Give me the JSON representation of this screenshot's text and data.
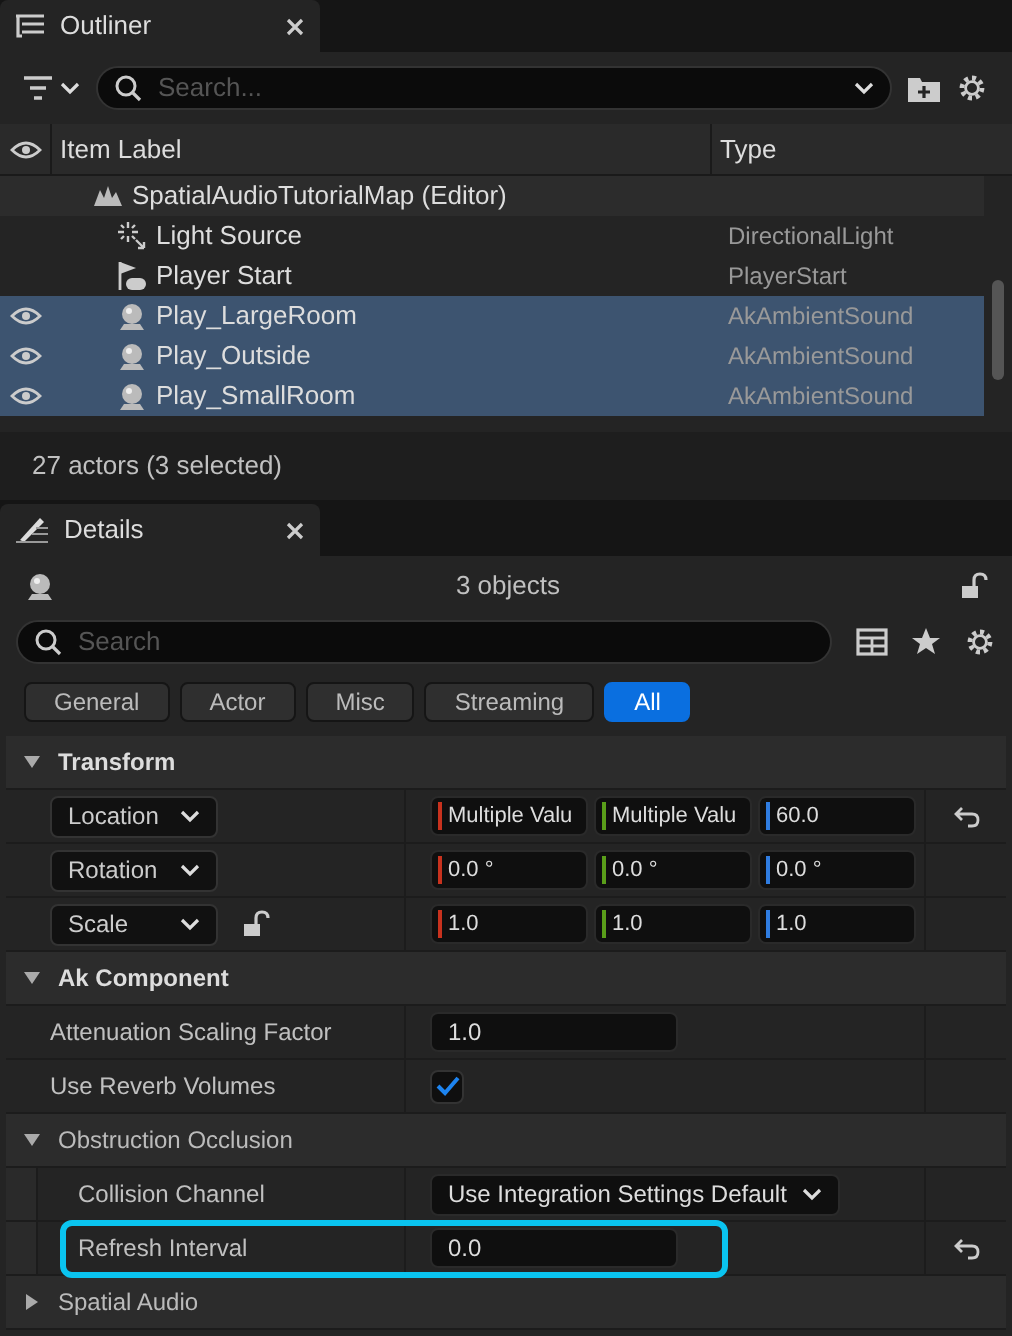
{
  "outliner": {
    "tab": "Outliner",
    "search": {
      "placeholder": "Search..."
    },
    "columns": [
      "Item Label",
      "Type"
    ],
    "rows": [
      {
        "kind": "map",
        "label": "SpatialAudioTutorialMap (Editor)",
        "type": "",
        "visible": false,
        "selected": false
      },
      {
        "kind": "light",
        "label": "Light Source",
        "type": "DirectionalLight",
        "visible": false,
        "selected": false
      },
      {
        "kind": "player",
        "label": "Player Start",
        "type": "PlayerStart",
        "visible": false,
        "selected": false
      },
      {
        "kind": "sound",
        "label": "Play_LargeRoom",
        "type": "AkAmbientSound",
        "visible": true,
        "selected": true
      },
      {
        "kind": "sound",
        "label": "Play_Outside",
        "type": "AkAmbientSound",
        "visible": true,
        "selected": true
      },
      {
        "kind": "sound",
        "label": "Play_SmallRoom",
        "type": "AkAmbientSound",
        "visible": true,
        "selected": true
      }
    ],
    "status": "27 actors (3 selected)"
  },
  "details": {
    "tab": "Details",
    "header": "3 objects",
    "search": {
      "placeholder": "Search"
    },
    "filters": [
      {
        "label": "General",
        "selected": false
      },
      {
        "label": "Actor",
        "selected": false
      },
      {
        "label": "Misc",
        "selected": false
      },
      {
        "label": "Streaming",
        "selected": false
      },
      {
        "label": "All",
        "selected": true
      }
    ],
    "sections": [
      {
        "title": "Transform",
        "expanded": true,
        "bold": true,
        "properties": [
          {
            "kind": "vector",
            "label": "Location",
            "resettable": true,
            "values": [
              {
                "text": "Multiple Valu",
                "color": "#c8321e"
              },
              {
                "text": "Multiple Valu",
                "color": "#5a9e1a"
              },
              {
                "text": "60.0",
                "color": "#2f7ce0"
              }
            ]
          },
          {
            "kind": "vector",
            "label": "Rotation",
            "resettable": false,
            "values": [
              {
                "text": "0.0 °",
                "color": "#c8321e"
              },
              {
                "text": "0.0 °",
                "color": "#5a9e1a"
              },
              {
                "text": "0.0 °",
                "color": "#2f7ce0"
              }
            ]
          },
          {
            "kind": "vector",
            "label": "Scale",
            "resettable": false,
            "locked": false,
            "values": [
              {
                "text": "1.0",
                "color": "#c8321e"
              },
              {
                "text": "1.0",
                "color": "#5a9e1a"
              },
              {
                "text": "1.0",
                "color": "#2f7ce0"
              }
            ]
          }
        ]
      },
      {
        "title": "Ak Component",
        "expanded": true,
        "bold": true,
        "properties": [
          {
            "kind": "number",
            "label": "Attenuation Scaling Factor",
            "value": "1.0",
            "resettable": false
          },
          {
            "kind": "checkbox",
            "label": "Use Reverb Volumes",
            "checked": true,
            "resettable": false
          }
        ]
      },
      {
        "title": "Obstruction Occlusion",
        "expanded": true,
        "bold": false,
        "nested": true,
        "properties": [
          {
            "kind": "dropdown",
            "label": "Collision Channel",
            "value": "Use Integration Settings Default",
            "resettable": false
          },
          {
            "kind": "number",
            "label": "Refresh Interval",
            "value": "0.0",
            "resettable": true,
            "highlighted": true
          }
        ]
      },
      {
        "title": "Spatial Audio",
        "expanded": false,
        "bold": false
      }
    ]
  }
}
